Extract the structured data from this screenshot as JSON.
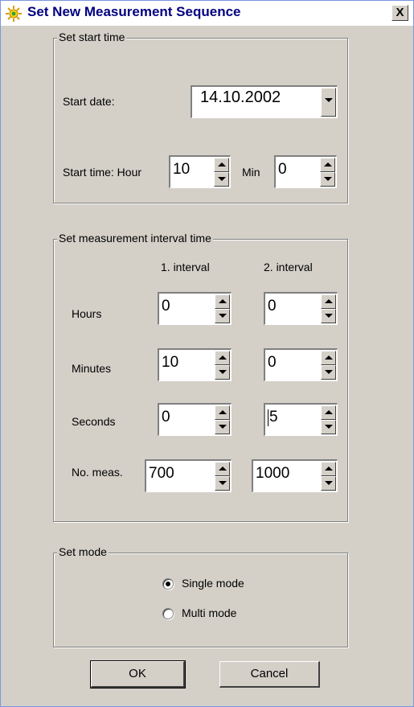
{
  "window": {
    "title": "Set New Measurement Sequence",
    "close_label": "X"
  },
  "start_group": {
    "legend": "Set start time",
    "start_date_label": "Start date:",
    "start_date_value": "14.10.2002",
    "start_time_label": "Start time:  Hour",
    "hour_value": "10",
    "min_label": "Min",
    "min_value": "0"
  },
  "interval_group": {
    "legend": "Set measurement interval time",
    "col1_header": "1. interval",
    "col2_header": "2. interval",
    "rows": [
      {
        "label": "Hours",
        "v1": "0",
        "v2": "0"
      },
      {
        "label": "Minutes",
        "v1": "10",
        "v2": "0"
      },
      {
        "label": "Seconds",
        "v1": "0",
        "v2": "5"
      },
      {
        "label": "No. meas.",
        "v1": "700",
        "v2": "1000"
      }
    ]
  },
  "mode_group": {
    "legend": "Set  mode",
    "options": [
      {
        "label": "Single mode",
        "selected": true
      },
      {
        "label": "Multi mode",
        "selected": false
      }
    ]
  },
  "buttons": {
    "ok": "OK",
    "cancel": "Cancel"
  }
}
